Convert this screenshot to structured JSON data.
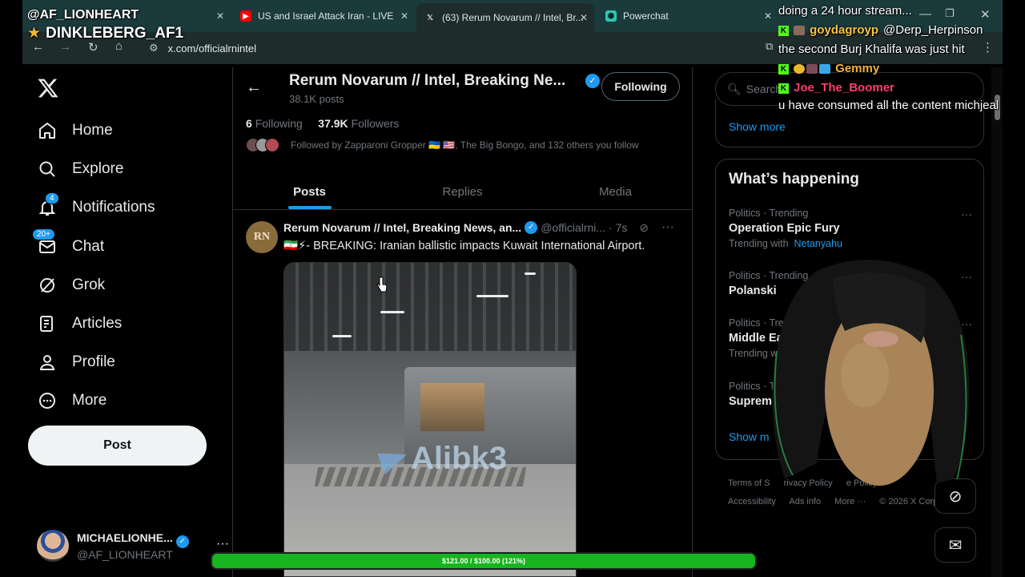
{
  "browser": {
    "tabs": [
      {
        "label": "",
        "icon": "x-icon",
        "active": false
      },
      {
        "label": "US and Israel Attack Iran - LIVE",
        "icon": "youtube-icon",
        "active": false
      },
      {
        "label": "(63) Rerum Novarum // Intel, Br...",
        "icon": "x-icon",
        "active": true
      },
      {
        "label": "Powerchat",
        "icon": "powerchat-icon",
        "active": false
      }
    ],
    "url": "x.com/officialrnintel"
  },
  "nav": {
    "items": [
      {
        "label": "Home",
        "icon": "home-icon"
      },
      {
        "label": "Explore",
        "icon": "search-icon"
      },
      {
        "label": "Notifications",
        "icon": "bell-icon",
        "badge": "4"
      },
      {
        "label": "Chat",
        "icon": "mail-icon",
        "badge": "20+"
      },
      {
        "label": "Grok",
        "icon": "grok-icon"
      },
      {
        "label": "Articles",
        "icon": "articles-icon"
      },
      {
        "label": "Profile",
        "icon": "person-icon"
      },
      {
        "label": "More",
        "icon": "more-circle-icon"
      }
    ],
    "post_label": "Post",
    "account_name": "MICHAELIONHE...",
    "account_handle": "@AF_LIONHEART"
  },
  "profile": {
    "name": "Rerum Novarum // Intel, Breaking Ne...",
    "posts": "38.1K posts",
    "following_btn": "Following",
    "following_count": "6",
    "following_label": "Following",
    "followers_count": "37.9K",
    "followers_label": "Followers",
    "followed_by": "Followed by Zapparoni Gropper 🇺🇦 🇺🇸, The Big Bongo, and 132 others you follow",
    "tabs": [
      "Posts",
      "Replies",
      "Media"
    ]
  },
  "tweet": {
    "avatar_text": "RN",
    "name": "Rerum Novarum // Intel, Breaking News, an...",
    "handle": "@officialrni...",
    "time": "· 7s",
    "text": "🇮🇷⚡- BREAKING: Iranian ballistic impacts Kuwait International Airport.",
    "watermark": "Alibk3"
  },
  "right": {
    "search_placeholder": "Search",
    "show_more": "Show more",
    "happening_title": "What’s happening",
    "trends": [
      {
        "cat": "Politics · Trending",
        "title": "Operation Epic Fury",
        "with_label": "Trending with",
        "with": "Netanyahu"
      },
      {
        "cat": "Politics · Trending",
        "title": "Polanski",
        "with_label": "",
        "with": ""
      },
      {
        "cat": "Politics · Trending",
        "title": "Middle East",
        "with_label": "Trending with",
        "with": ""
      },
      {
        "cat": "Politics · Tren",
        "title": "Supremo",
        "with_label": "",
        "with": ""
      }
    ],
    "show_more_2": "Show m",
    "footer": [
      "Terms of S",
      "rivacy Policy",
      "e Policy",
      "Accessibility",
      "Ads info",
      "More ···",
      "© 2026 X Corp"
    ]
  },
  "overlay": {
    "streamer": "@AF_LIONHEART",
    "donor": "DINKLEBERG_AF1",
    "chat": [
      {
        "user": "",
        "msg": "doing a 24 hour stream..."
      },
      {
        "user": "goydagroyp",
        "msg": "@Derp_Herpinson"
      },
      {
        "user": "",
        "msg": "the second Burj Khalifa was just hit"
      },
      {
        "user": "Gemmy",
        "msg": ""
      },
      {
        "user": "Joe_The_Boomer",
        "msg": "u have consumed all the content michjeal"
      }
    ],
    "progress_text": "$121.00 / $100.00 (121%)",
    "progress_fraction": 1.0
  },
  "colors": {
    "accent": "#1d9bf0",
    "progress_green": "#16b51f",
    "kick_green": "#53fc18"
  }
}
